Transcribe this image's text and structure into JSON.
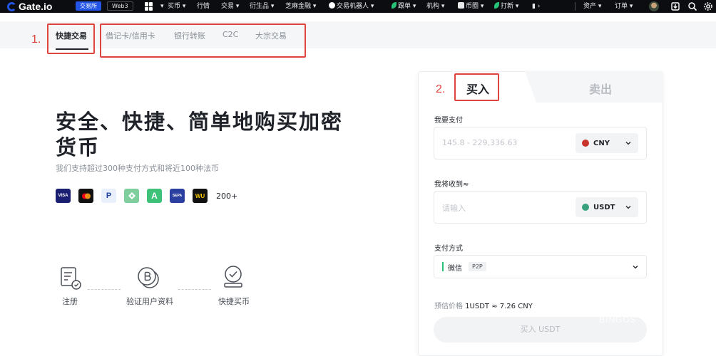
{
  "topnav": {
    "logo": "Gate.io",
    "tab_active": "交易所",
    "tab_web3": "Web3",
    "items": [
      "买币 ▾",
      "行情",
      "交易 ▾",
      "衍生品 ▾",
      "芝麻金融 ▾",
      "交易机器人 ▾",
      "跟单 ▾",
      "机构 ▾",
      "币圈 ▾",
      "打新 ▾"
    ],
    "right_items": [
      "资产 ▾",
      "订单 ▾"
    ]
  },
  "subnav": {
    "tabs": [
      "快捷交易",
      "借记卡/信用卡",
      "银行转账",
      "C2C",
      "大宗交易"
    ],
    "annotation_1": "1.",
    "annotation_2": "2."
  },
  "hero": {
    "title": "安全、快捷、简单地购买加密货币",
    "subtitle": "我们支持超过300种支付方式和将近100种法币",
    "payments": [
      {
        "name": "visa",
        "label": "VISA",
        "color": "#1a1f71"
      },
      {
        "name": "mastercard",
        "label": "",
        "color": "#111111"
      },
      {
        "name": "paypal",
        "label": "P",
        "color": "#e9f0fb"
      },
      {
        "name": "green-diamond",
        "label": "",
        "color": "#7fcf9e"
      },
      {
        "name": "a-logo",
        "label": "A",
        "color": "#3ec27a"
      },
      {
        "name": "sepa",
        "label": "SEPA",
        "color": "#2b3fa0"
      },
      {
        "name": "western-union",
        "label": "WU",
        "color": "#111111"
      }
    ],
    "payments_more": "200+"
  },
  "steps": [
    "注册",
    "验证用户资料",
    "快捷买币"
  ],
  "card": {
    "buy_tab": "买入",
    "sell_tab": "卖出",
    "pay_label": "我要支付",
    "pay_placeholder": "145.8 - 229,336.63",
    "pay_currency": "CNY",
    "receive_label": "我将收到≈",
    "receive_placeholder": "请输入",
    "receive_currency": "USDT",
    "method_label": "支付方式",
    "method_name": "微信",
    "method_badge": "P2P",
    "estimate_label": "预估价格",
    "estimate_value": "1USDT ≈ 7.26 CNY",
    "buy_button": "买入 USDT"
  },
  "watermark": "BINGOS",
  "colors": {
    "brand": "#2354e6",
    "annotation": "#e0443e",
    "cny_dot": "#c8332b",
    "usdt_dot": "#3aa17e",
    "wechat": "#28c17a"
  }
}
